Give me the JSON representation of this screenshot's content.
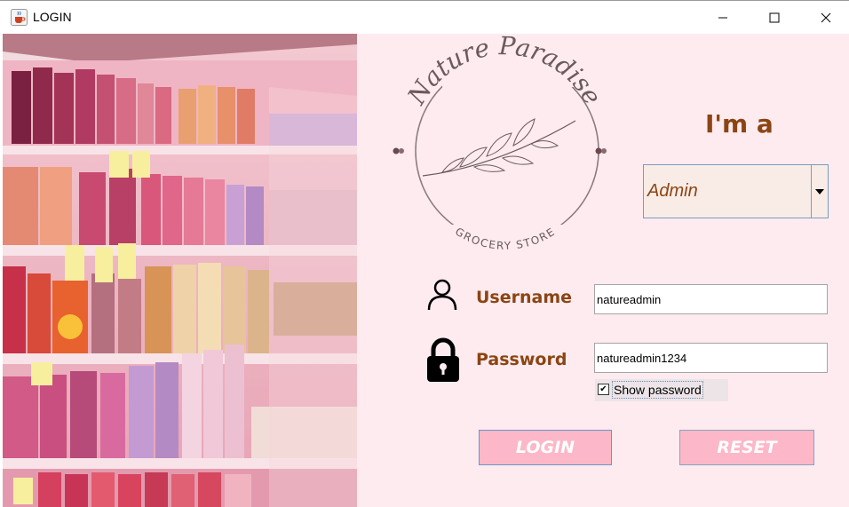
{
  "window": {
    "title": "LOGIN",
    "icon": "java-cup-icon",
    "controls": [
      "minimize-icon",
      "maximize-icon",
      "close-icon"
    ]
  },
  "logo": {
    "brand": "Nature Paradise",
    "subtitle": "GROCERY STORE"
  },
  "role": {
    "heading": "I'm a",
    "selected": "Admin"
  },
  "form": {
    "username_label": "Username",
    "username_value": "natureadmin",
    "password_label": "Password",
    "password_value": "natureadmin1234",
    "show_password_label": "Show password",
    "show_password_checked": true
  },
  "buttons": {
    "login_label": "LOGIN",
    "reset_label": "RESET"
  },
  "colors": {
    "accent_text": "#8b4513",
    "panel_bg": "#fdebf0",
    "button_bg": "#fcb8c8"
  }
}
